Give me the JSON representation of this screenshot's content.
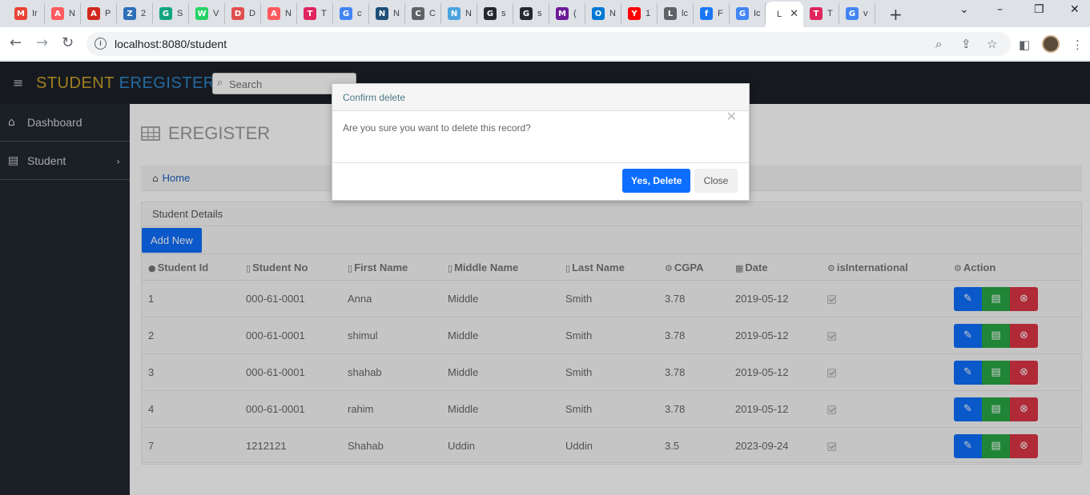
{
  "browser": {
    "tabs": [
      {
        "label": "Ir",
        "icon": "gmail-icon",
        "color": "#ea4335",
        "glyph": "M"
      },
      {
        "label": "N",
        "icon": "airbnb-icon",
        "color": "#ff5a5f",
        "glyph": "A"
      },
      {
        "label": "P",
        "icon": "adp-icon",
        "color": "#d0271d",
        "glyph": "A"
      },
      {
        "label": "2",
        "icon": "site-icon",
        "color": "#2d6fb7",
        "glyph": "Z"
      },
      {
        "label": "S",
        "icon": "chatgpt-icon",
        "color": "#10a37f",
        "glyph": "G"
      },
      {
        "label": "V",
        "icon": "whatsapp-icon",
        "color": "#25d366",
        "glyph": "W"
      },
      {
        "label": "D",
        "icon": "site-icon",
        "color": "#e04e4e",
        "glyph": "D"
      },
      {
        "label": "N",
        "icon": "airbnb-icon",
        "color": "#ff5a5f",
        "glyph": "A"
      },
      {
        "label": "T",
        "icon": "site-icon",
        "color": "#e0245e",
        "glyph": "T"
      },
      {
        "label": "c",
        "icon": "google-icon",
        "color": "#4285f4",
        "glyph": "G"
      },
      {
        "label": "N",
        "icon": "site-icon",
        "color": "#1e4f78",
        "glyph": "N"
      },
      {
        "label": "C",
        "icon": "globe-icon",
        "color": "#5f6368",
        "glyph": "C"
      },
      {
        "label": "N",
        "icon": "site-icon",
        "color": "#4aa3df",
        "glyph": "N"
      },
      {
        "label": "s",
        "icon": "github-icon",
        "color": "#24292f",
        "glyph": "G"
      },
      {
        "label": "s",
        "icon": "github-icon",
        "color": "#24292f",
        "glyph": "G"
      },
      {
        "label": "(",
        "icon": "mail-icon",
        "color": "#6a1b9a",
        "glyph": "M"
      },
      {
        "label": "N",
        "icon": "outlook-icon",
        "color": "#0078d4",
        "glyph": "O"
      },
      {
        "label": "1",
        "icon": "youtube-icon",
        "color": "#ff0000",
        "glyph": "Y"
      },
      {
        "label": "lc",
        "icon": "globe-icon",
        "color": "#5f6368",
        "glyph": "L"
      },
      {
        "label": "F",
        "icon": "facebook-icon",
        "color": "#1877f2",
        "glyph": "f"
      },
      {
        "label": "Ic",
        "icon": "google-icon",
        "color": "#4285f4",
        "glyph": "G"
      },
      {
        "label": "L",
        "icon": "active-tab-icon",
        "color": "#ffffff",
        "glyph": ""
      },
      {
        "label": "T",
        "icon": "site-icon",
        "color": "#e0245e",
        "glyph": "T"
      },
      {
        "label": "v",
        "icon": "google-icon",
        "color": "#4285f4",
        "glyph": "G"
      }
    ],
    "url": "localhost:8080/student"
  },
  "app": {
    "brand_part1": "STUDENT",
    "brand_part2": "EREGISTER",
    "search_placeholder": "Search",
    "sidebar": [
      {
        "label": "Dashboard",
        "icon": "home-icon"
      },
      {
        "label": "Student",
        "icon": "list-icon"
      }
    ],
    "page_title": "EREGISTER",
    "breadcrumb_home": "Home",
    "panel_title": "Student Details",
    "add_button": "Add New",
    "columns": [
      "Student Id",
      "Student No",
      "First Name",
      "Middle Name",
      "Last Name",
      "CGPA",
      "Date",
      "isInternational",
      "Action"
    ],
    "rows": [
      {
        "id": "1",
        "no": "000-61-0001",
        "first": "Anna",
        "middle": "Middle",
        "last": "Smith",
        "cgpa": "3.78",
        "date": "2019-05-12",
        "international": true
      },
      {
        "id": "2",
        "no": "000-61-0001",
        "first": "shimul",
        "middle": "Middle",
        "last": "Smith",
        "cgpa": "3.78",
        "date": "2019-05-12",
        "international": true
      },
      {
        "id": "3",
        "no": "000-61-0001",
        "first": "shahab",
        "middle": "Middle",
        "last": "Smith",
        "cgpa": "3.78",
        "date": "2019-05-12",
        "international": true
      },
      {
        "id": "4",
        "no": "000-61-0001",
        "first": "rahim",
        "middle": "Middle",
        "last": "Smith",
        "cgpa": "3.78",
        "date": "2019-05-12",
        "international": true
      },
      {
        "id": "7",
        "no": "1212121",
        "first": "Shahab",
        "middle": "Uddin",
        "last": "Uddin",
        "cgpa": "3.5",
        "date": "2023-09-24",
        "international": true
      }
    ]
  },
  "modal": {
    "title": "Confirm delete",
    "message": "Are you sure you want to delete this record?",
    "confirm_label": "Yes, Delete",
    "close_label": "Close"
  },
  "colors": {
    "primary": "#0d6efd",
    "success": "#28a745",
    "danger": "#dc3545",
    "nav_bg": "#1c2128",
    "brand_gold": "#c9a227",
    "brand_blue": "#2e86c9"
  }
}
